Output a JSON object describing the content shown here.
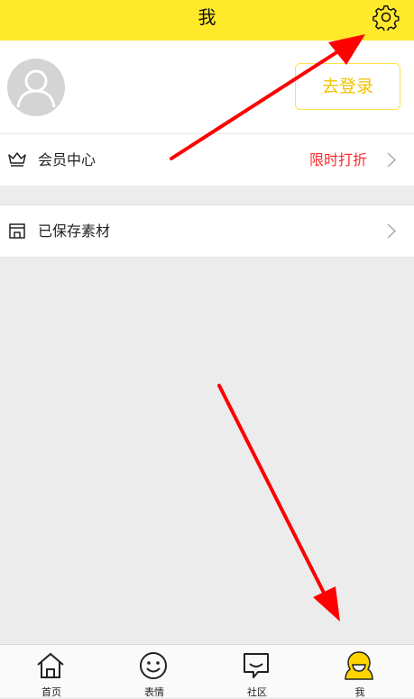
{
  "header": {
    "title": "我"
  },
  "profile": {
    "login_label": "去登录"
  },
  "menu": {
    "vip": {
      "label": "会员中心",
      "promo": "限时打折"
    },
    "saved": {
      "label": "已保存素材"
    }
  },
  "tabbar": {
    "items": [
      {
        "label": "首页",
        "icon": "home-icon",
        "active": false
      },
      {
        "label": "表情",
        "icon": "smiley-icon",
        "active": false
      },
      {
        "label": "社区",
        "icon": "chat-icon",
        "active": false
      },
      {
        "label": "我",
        "icon": "profile-icon",
        "active": true
      }
    ]
  },
  "colors": {
    "accent": "#ffe92b",
    "promo": "#ff2b2b",
    "login": "#f2c200",
    "annotation": "#ff0000"
  }
}
